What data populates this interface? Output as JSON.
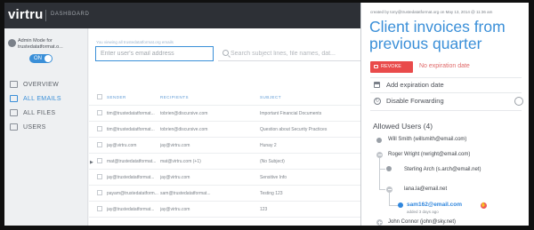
{
  "app": {
    "logo": "virtru",
    "section": "DASHBOARD"
  },
  "sidebar": {
    "mode_label": "Admin Mode for trustedatatformat.o...",
    "toggle_label": "ON",
    "items": [
      {
        "label": "OVERVIEW",
        "icon": "overview-icon"
      },
      {
        "label": "ALL EMAILS",
        "icon": "mail-icon",
        "active": true
      },
      {
        "label": "ALL FILES",
        "icon": "file-icon"
      },
      {
        "label": "USERS",
        "icon": "users-icon"
      }
    ]
  },
  "main": {
    "field_label": "You viewing all trustedatatformat.org emails",
    "email_placeholder": "Enter user's email address",
    "search_placeholder": "Search subject lines, file names, dat...",
    "columns": [
      "SENDER",
      "RECIPIENTS",
      "SUBJECT"
    ],
    "rows": [
      {
        "sender": "tim@trustedatatformat...",
        "recipients": "tobrien@discursive.com",
        "subject": "Important Financial Documents",
        "unread": false
      },
      {
        "sender": "tim@trustedatatformat...",
        "recipients": "tobrien@discursive.com",
        "subject": "Question about Security Practices",
        "unread": false
      },
      {
        "sender": "jay@virtru.com",
        "recipients": "jay@virtru.com",
        "subject": "Hunay 2",
        "unread": false
      },
      {
        "sender": "mat@trustedatatformat...",
        "recipients": "mat@virtru.com (+1)",
        "subject": "(No Subject)",
        "unread": true
      },
      {
        "sender": "jay@trustedatatformat...",
        "recipients": "jay@virtru.com",
        "subject": "Sensitive Info",
        "unread": false
      },
      {
        "sender": "payam@trustedatatform...",
        "recipients": "sam@trustedatatformat...",
        "subject": "Testing 123",
        "unread": false
      },
      {
        "sender": "jay@trustedatatformat...",
        "recipients": "jay@virtru.com",
        "subject": "123",
        "unread": false
      }
    ]
  },
  "panel": {
    "created_text": "created by tony@trustedatatformat.org on May 13, 2014 @ 11:36 am",
    "title": "Client invoices from previous quarter",
    "revoke_label": "REVOKE",
    "expiry_note": "No expiration date",
    "add_expiration": "Add expiration date",
    "disable_forwarding": "Disable Forwarding",
    "users_heading": "Allowed Users (4)",
    "users": [
      {
        "label": "Will Smith (willsmith@email.com)"
      },
      {
        "label": "Roger Wright (rwright@email.com)"
      },
      {
        "label": "Sterling Arch (s.arch@email.net)"
      },
      {
        "label": "lana.la@email.net"
      },
      {
        "label": "sam162@email.com",
        "added": "added 3 days ago"
      },
      {
        "label": "John Connor (john@sky.net)"
      }
    ],
    "colors": {
      "accent": "#3a8fd8",
      "revoke": "#e94b4b",
      "highlight": "#2f86dd"
    }
  }
}
